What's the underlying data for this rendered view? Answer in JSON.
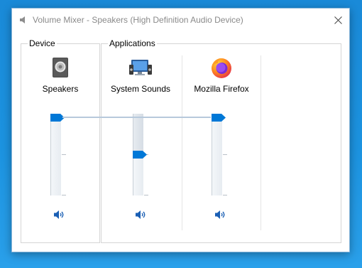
{
  "window": {
    "title": "Volume Mixer - Speakers (High Definition Audio Device)"
  },
  "device": {
    "section_label": "Device",
    "name": "Speakers",
    "icon": "speaker-device-icon",
    "volume_percent": 100
  },
  "applications": {
    "section_label": "Applications",
    "items": [
      {
        "name": "System Sounds",
        "icon": "system-sounds-icon",
        "volume_percent": 50
      },
      {
        "name": "Mozilla Firefox",
        "icon": "firefox-icon",
        "volume_percent": 100
      }
    ]
  },
  "colors": {
    "accent": "#0078d7",
    "desktop": "#1c93e0"
  }
}
